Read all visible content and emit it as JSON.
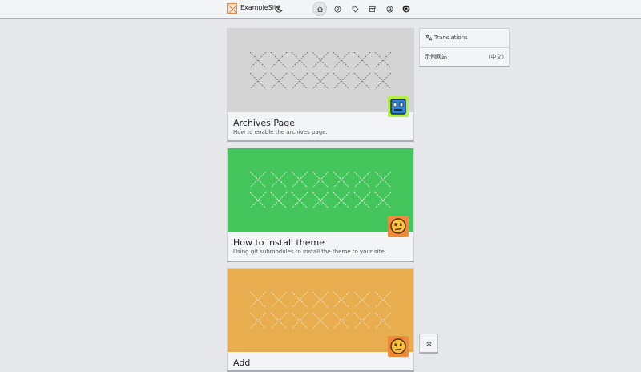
{
  "header": {
    "site_title": "ExampleSite",
    "nav": [
      "home-icon",
      "help-icon",
      "tag-icon",
      "archive-icon",
      "user-icon",
      "github-icon"
    ]
  },
  "posts": [
    {
      "title": "Archives Page",
      "description": "How to enable the archives page.",
      "banner_color": "#d4d4d4",
      "pattern_color": "#7a7a7a",
      "avatar": "robot-avatar",
      "avatar_bg": "#b5f142"
    },
    {
      "title": "How to install theme",
      "description": "Using git submodules to install the theme to your site.",
      "banner_color": "#43c55c",
      "pattern_color": "#e6f5e6",
      "avatar": "face-avatar",
      "avatar_bg": "#ef8a3a"
    },
    {
      "title": "Add",
      "description": "",
      "banner_color": "#e8ad4f",
      "pattern_color": "#f6e2bf",
      "avatar": "face-avatar",
      "avatar_bg": "#ef8a3a"
    }
  ],
  "sidebar": {
    "heading": "Translations",
    "items": [
      {
        "label": "示例网站",
        "lang": "(中文)"
      }
    ]
  },
  "back_to_top": "chevrons-up-icon"
}
